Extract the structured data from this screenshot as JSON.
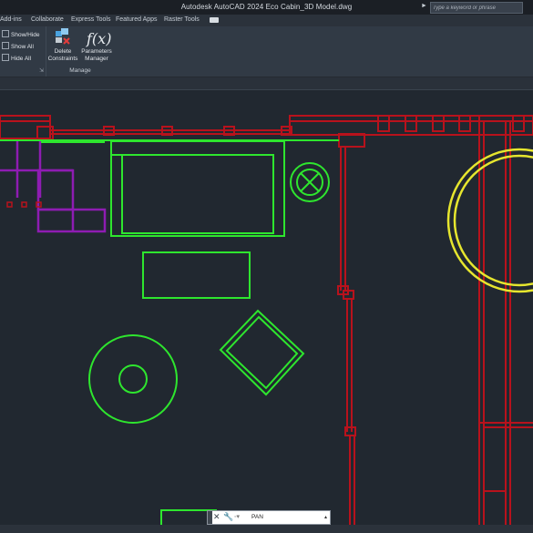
{
  "titlebar": {
    "title": "Autodesk AutoCAD 2024   Eco Cabin_3D Model.dwg",
    "search_placeholder": "Type a keyword or phrase"
  },
  "tabs": [
    {
      "label": "Add-ins"
    },
    {
      "label": "Collaborate"
    },
    {
      "label": "Express Tools"
    },
    {
      "label": "Featured Apps"
    },
    {
      "label": "Raster Tools"
    }
  ],
  "ribbon": {
    "visibility": [
      {
        "label": "Show/Hide"
      },
      {
        "label": "Show All"
      },
      {
        "label": "Hide All"
      }
    ],
    "delete_constraints": {
      "line1": "Delete",
      "line2": "Constraints"
    },
    "parameters_manager": {
      "line1": "Parameters",
      "line2": "Manager",
      "glyph": "f(x)"
    },
    "panel_label": "Manage"
  },
  "command_line": {
    "text": "PAN"
  },
  "colors": {
    "background": "#212830",
    "walls": "#b8121c",
    "furniture": "#2ee62e",
    "purple": "#8e1cb2",
    "yellow": "#e6e62e"
  }
}
